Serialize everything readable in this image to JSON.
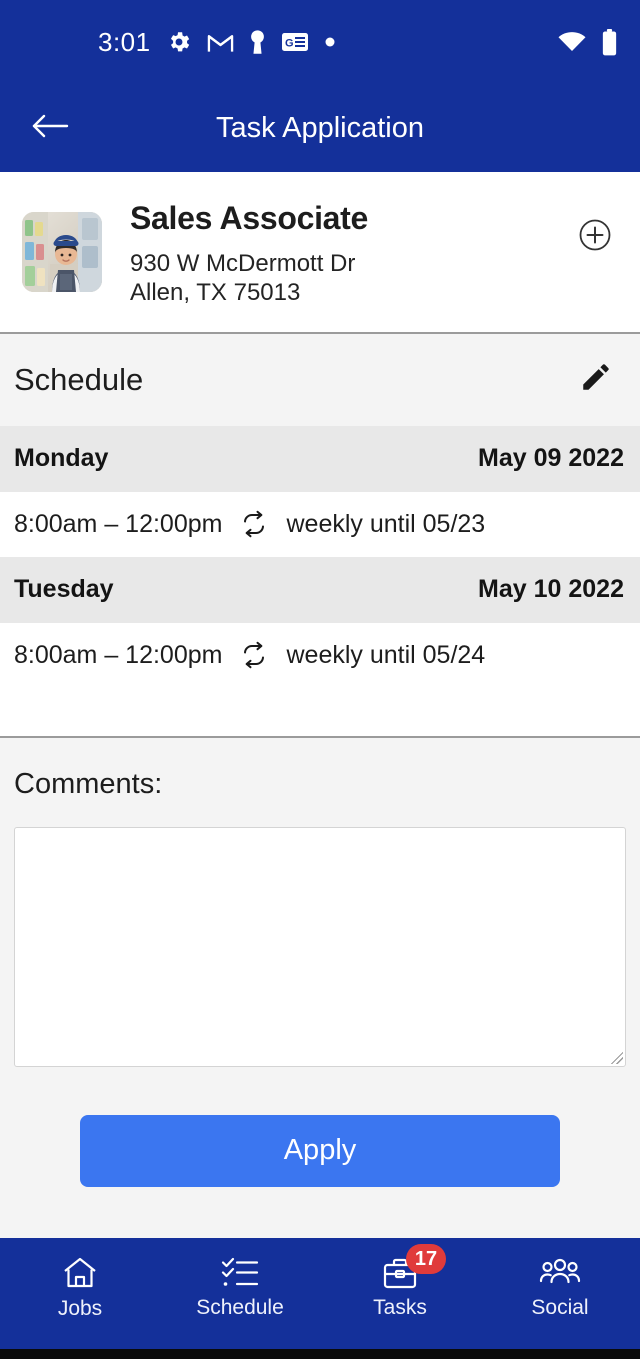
{
  "statusbar": {
    "time": "3:01",
    "icons": [
      "gear-icon",
      "gmail-icon",
      "keyhole-icon",
      "google-news-icon",
      "dot-icon"
    ],
    "right_icons": [
      "wifi-icon",
      "battery-icon"
    ]
  },
  "appbar": {
    "title": "Task Application",
    "back_icon": "back-arrow-icon"
  },
  "job": {
    "title": "Sales Associate",
    "address_line1": "930 W McDermott Dr",
    "address_line2": "Allen, TX 75013",
    "address": "930 W McDermott Dr\nAllen, TX 75013",
    "add_icon": "plus-circle-icon",
    "thumbnail": "sales-associate-photo"
  },
  "schedule": {
    "title": "Schedule",
    "edit_icon": "pencil-icon",
    "entries": [
      {
        "day": "Monday",
        "date": "May 09 2022",
        "time": "8:00am – 12:00pm",
        "recurrence": "weekly until 05/23",
        "recurrence_icon": "repeat-icon"
      },
      {
        "day": "Tuesday",
        "date": "May 10 2022",
        "time": "8:00am – 12:00pm",
        "recurrence": "weekly until 05/24",
        "recurrence_icon": "repeat-icon"
      }
    ]
  },
  "comments": {
    "label": "Comments:",
    "value": "",
    "placeholder": ""
  },
  "apply": {
    "label": "Apply",
    "color": "#3b76f0"
  },
  "bottomnav": {
    "items": [
      {
        "label": "Jobs",
        "icon": "home-icon",
        "badge": ""
      },
      {
        "label": "Schedule",
        "icon": "checklist-icon",
        "badge": ""
      },
      {
        "label": "Tasks",
        "icon": "briefcase-icon",
        "badge": "17"
      },
      {
        "label": "Social",
        "icon": "people-group-icon",
        "badge": ""
      }
    ],
    "badge_color": "#e03b3b"
  },
  "colors": {
    "header_blue": "#14309a",
    "accent_blue": "#3b76f0",
    "section_bg": "#f4f4f4",
    "day_row_bg": "#e8e8e8",
    "badge_red": "#e03b3b"
  }
}
